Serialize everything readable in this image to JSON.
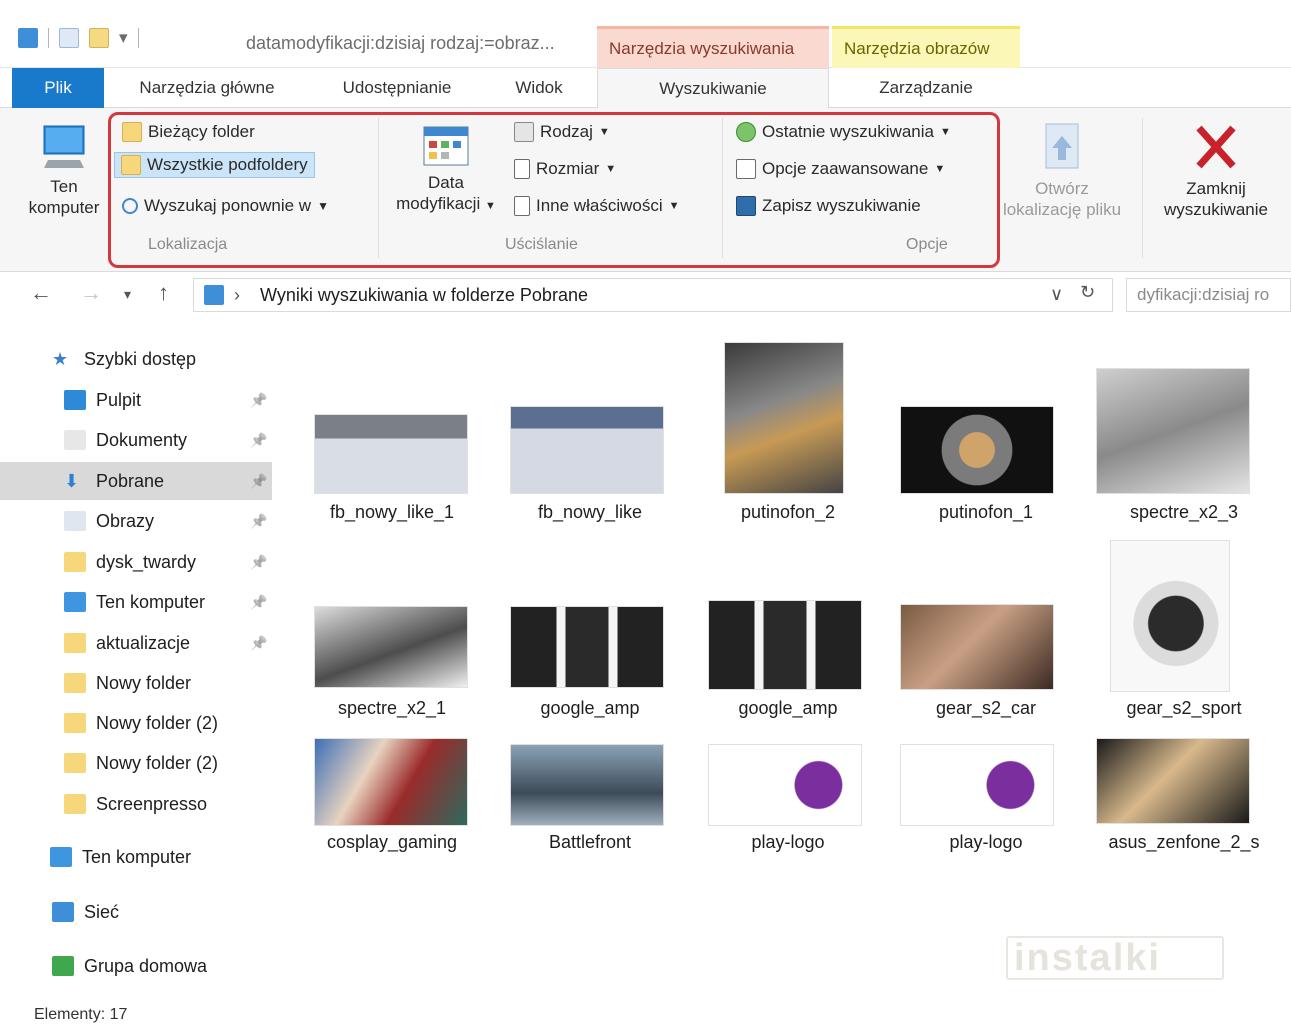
{
  "window": {
    "title": "datamodyfikacji:dzisiaj rodzaj:=obraz...",
    "context_tabs": [
      "Narzędzia wyszukiwania",
      "Narzędzia obrazów"
    ]
  },
  "tabs": [
    "Plik",
    "Narzędzia główne",
    "Udostępnianie",
    "Widok",
    "Wyszukiwanie",
    "Zarządzanie"
  ],
  "ribbon": {
    "ten_komputer": [
      "Ten",
      "komputer"
    ],
    "location": {
      "current_folder": "Bieżący folder",
      "all_subfolders": "Wszystkie podfoldery",
      "search_again": "Wyszukaj ponownie w",
      "group_label": "Lokalizacja"
    },
    "refine": {
      "date_modified": [
        "Data",
        "modyfikacji"
      ],
      "kind": "Rodzaj",
      "size": "Rozmiar",
      "other_props": "Inne właściwości",
      "group_label": "Uściślanie"
    },
    "options": {
      "recent": "Ostatnie wyszukiwania",
      "advanced": "Opcje zaawansowane",
      "save": "Zapisz wyszukiwanie",
      "group_label": "Opcje"
    },
    "open_location": [
      "Otwórz",
      "lokalizację pliku"
    ],
    "close_search": [
      "Zamknij",
      "wyszukiwanie"
    ]
  },
  "address": {
    "path": "Wyniki wyszukiwania w folderze Pobrane",
    "search_value": "dyfikacji:dzisiaj ro"
  },
  "sidebar": {
    "items": [
      {
        "label": "Szybki dostęp",
        "icon": "star-icon",
        "pinned": false
      },
      {
        "label": "Pulpit",
        "icon": "desktop-icon",
        "pinned": true
      },
      {
        "label": "Dokumenty",
        "icon": "documents-icon",
        "pinned": true
      },
      {
        "label": "Pobrane",
        "icon": "download-icon",
        "pinned": true,
        "selected": true
      },
      {
        "label": "Obrazy",
        "icon": "pictures-icon",
        "pinned": true
      },
      {
        "label": "dysk_twardy",
        "icon": "folder-icon",
        "pinned": true
      },
      {
        "label": "Ten komputer",
        "icon": "computer-icon",
        "pinned": true
      },
      {
        "label": "aktualizacje",
        "icon": "folder-icon",
        "pinned": true
      },
      {
        "label": "Nowy folder",
        "icon": "folder-icon",
        "pinned": false
      },
      {
        "label": "Nowy folder (2)",
        "icon": "folder-icon",
        "pinned": false
      },
      {
        "label": "Nowy folder (2)",
        "icon": "folder-icon",
        "pinned": false
      },
      {
        "label": "Screenpresso",
        "icon": "folder-icon",
        "pinned": false
      },
      {
        "label": "Ten komputer",
        "icon": "computer-icon",
        "pinned": false
      },
      {
        "label": "Sieć",
        "icon": "network-icon",
        "pinned": false
      },
      {
        "label": "Grupa domowa",
        "icon": "homegroup-icon",
        "pinned": false
      }
    ]
  },
  "files": [
    {
      "name": "fb_nowy_like_1"
    },
    {
      "name": "fb_nowy_like"
    },
    {
      "name": "putinofon_2"
    },
    {
      "name": "putinofon_1"
    },
    {
      "name": "spectre_x2_3"
    },
    {
      "name": "spectre_x2_1"
    },
    {
      "name": "google_amp"
    },
    {
      "name": "google_amp"
    },
    {
      "name": "gear_s2_car"
    },
    {
      "name": "gear_s2_sport"
    },
    {
      "name": "cosplay_gaming"
    },
    {
      "name": "Battlefront"
    },
    {
      "name": "play-logo"
    },
    {
      "name": "play-logo"
    },
    {
      "name": "asus_zenfone_2_s"
    }
  ],
  "status": "Elementy: 17",
  "watermark": "instalki",
  "colors": {
    "file_tab": "#1979ca",
    "highlight": "#d2393f",
    "ctx_search": "#f9d9d0",
    "ctx_images": "#fbf7b6"
  }
}
